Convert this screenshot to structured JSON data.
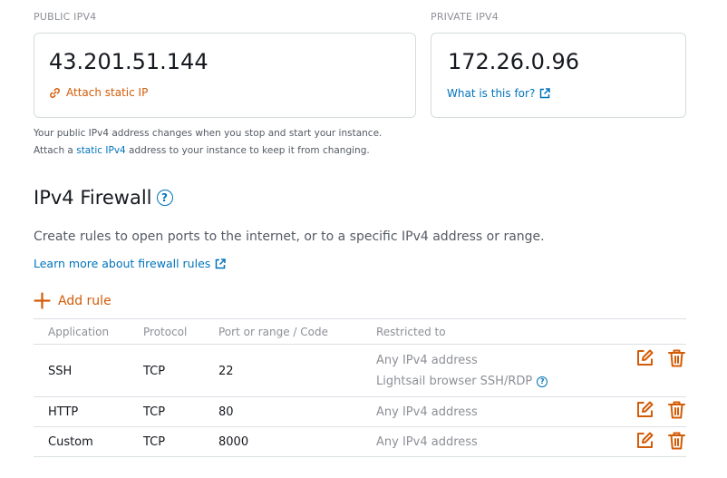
{
  "public_ip": {
    "section_label": "PUBLIC IPV4",
    "address": "43.201.51.144",
    "action_label": "Attach static IP"
  },
  "private_ip": {
    "section_label": "PRIVATE IPV4",
    "address": "172.26.0.96",
    "help_link": "What is this for?"
  },
  "note": {
    "line1": "Your public IPv4 address changes when you stop and start your instance.",
    "line2_prefix": "Attach a ",
    "line2_link": "static IPv4",
    "line2_suffix": " address to your instance to keep it from changing."
  },
  "firewall": {
    "title": "IPv4 Firewall",
    "description": "Create rules to open ports to the internet, or to a specific IPv4 address or range.",
    "learn_more": "Learn more about firewall rules",
    "add_rule": "Add rule",
    "columns": [
      "Application",
      "Protocol",
      "Port or range / Code",
      "Restricted to"
    ],
    "rows": [
      {
        "application": "SSH",
        "protocol": "TCP",
        "port": "22",
        "restricted": "Any IPv4 address",
        "restricted_extra": "Lightsail browser SSH/RDP"
      },
      {
        "application": "HTTP",
        "protocol": "TCP",
        "port": "80",
        "restricted": "Any IPv4 address"
      },
      {
        "application": "Custom",
        "protocol": "TCP",
        "port": "8000",
        "restricted": "Any IPv4 address"
      }
    ]
  },
  "icons": {
    "attach": "link-icon",
    "external": "external-link-icon",
    "help": "help-icon",
    "add": "plus-icon",
    "edit": "edit-icon",
    "delete": "trash-icon"
  },
  "colors": {
    "accent_orange": "#d45b07",
    "link_blue": "#0073bb",
    "muted_text": "#8d9096"
  }
}
